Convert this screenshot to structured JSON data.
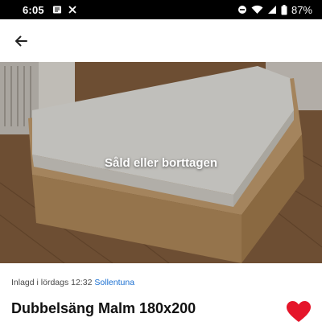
{
  "status_bar": {
    "time": "6:05",
    "battery_percent": "87%",
    "icons": [
      "message-icon",
      "missed-call-icon",
      "dnd-icon",
      "wifi-icon",
      "signal-icon",
      "battery-icon"
    ]
  },
  "header": {
    "back_icon": "arrow-left-icon"
  },
  "listing": {
    "image_overlay_text": "Såld eller borttagen",
    "meta_text": "Inlagd i lördags 12:32",
    "location": "Sollentuna",
    "title": "Dubbelsäng Malm 180x200",
    "favorite_icon": "heart-icon",
    "favorite_color": "#e5152a"
  },
  "colors": {
    "link": "#1a6fd1",
    "status_bar_bg": "#000000"
  }
}
